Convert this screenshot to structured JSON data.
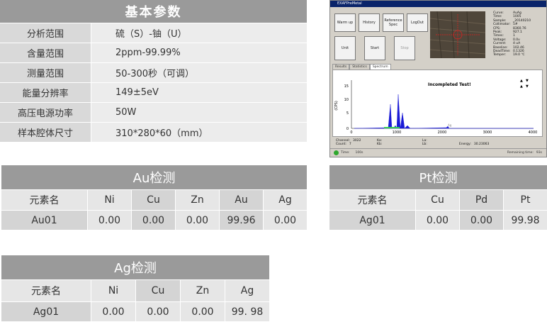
{
  "params": {
    "title": "基本参数",
    "rows": [
      {
        "label": "分析范围",
        "value": "硫（S）-铀（U）"
      },
      {
        "label": "含量范围",
        "value": "2ppm-99.99%"
      },
      {
        "label": "测量范围",
        "value": "50-300秒（可调）"
      },
      {
        "label": "能量分辨率",
        "value": "149±5eV"
      },
      {
        "label": "高压电源功率",
        "value": "50W"
      },
      {
        "label": "样本腔体尺寸",
        "value": "310*280*60（mm）"
      }
    ]
  },
  "software": {
    "title": "EXAFPreMetal",
    "buttons": {
      "warmup": "Warm up",
      "history": "History",
      "refspec": "Reference Spec",
      "logout": "LogOut",
      "unit": "Unit",
      "start": "Start",
      "stop": "Stop"
    },
    "readout": [
      [
        "Curve:",
        "AuAg"
      ],
      [
        "Time:",
        "1005"
      ],
      [
        "Sample:",
        "_20140210"
      ],
      [
        "Collimator:",
        "5#"
      ],
      [
        "CPS:",
        "8360.76"
      ],
      [
        "Peak:",
        "927.1"
      ],
      [
        "Times:",
        "1"
      ],
      [
        "Voltage:",
        "0.0v"
      ],
      [
        "Current:",
        "4 uA"
      ],
      [
        "Baseline:",
        "102.46"
      ],
      [
        "DeadTime:",
        "0.1326"
      ],
      [
        "Temper:",
        "19.0 ℃"
      ]
    ],
    "tabs": [
      "Results",
      "Statistics",
      "Spectrum"
    ],
    "plot_message": "Incompleted Test!",
    "y_label": "(CPS)",
    "y_ticks": [
      "15",
      "10",
      "5",
      "0"
    ],
    "x_ticks": [
      "0",
      "1000",
      "2000",
      "3000",
      "4000"
    ],
    "ag_marker": "Ag",
    "side_icons": [
      "▲",
      "▼",
      "▲",
      "▼"
    ],
    "info": {
      "channel_label": "Channel:",
      "channel": "3022",
      "count_label": "Count:",
      "count": "7",
      "ka": "Ka:",
      "kb": "Kb:",
      "la": "La:",
      "lb": "Lb:",
      "energy_label": "Energy:",
      "energy": "30.23063"
    },
    "status": {
      "time_label": "Time:",
      "time": "100s",
      "remaining_label": "Remaining time:",
      "remaining": "93s"
    }
  },
  "au": {
    "title": "Au检测",
    "headers": [
      "元素名",
      "Ni",
      "Cu",
      "Zn",
      "Au",
      "Ag"
    ],
    "values": [
      "Au01",
      "0.00",
      "0.00",
      "0.00",
      "99.96",
      "0.00"
    ]
  },
  "pt": {
    "title": "Pt检测",
    "headers": [
      "元素名",
      "Cu",
      "Pd",
      "Pt"
    ],
    "values": [
      "Ag01",
      "0.00",
      "0.00",
      "99.98"
    ]
  },
  "ag": {
    "title": "Ag检测",
    "headers": [
      "元素名",
      "Ni",
      "Cu",
      "Zn",
      "Ag"
    ],
    "values": [
      "Ag01",
      "0.00",
      "0.00",
      "0.00",
      "99. 98"
    ]
  },
  "colors": {
    "header_bg": "#9a9a9a",
    "spectrum": "#1a1ad6",
    "title_bar": "#0a246a"
  }
}
